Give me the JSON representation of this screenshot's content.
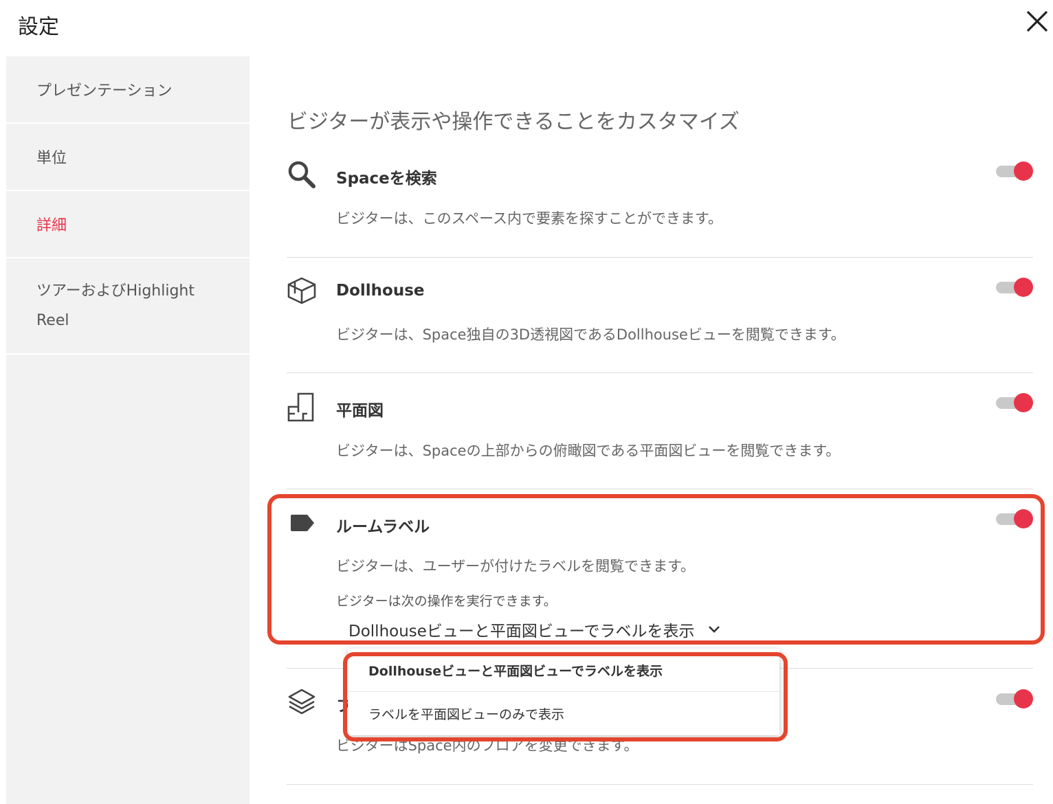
{
  "window": {
    "title": "設定"
  },
  "sidebar": {
    "items": [
      {
        "label": "プレゼンテーション",
        "active": false
      },
      {
        "label": "単位",
        "active": false
      },
      {
        "label": "詳細",
        "active": true
      },
      {
        "label": "ツアーおよびHighlight Reel",
        "active": false
      }
    ]
  },
  "main": {
    "headline": "ビジターが表示や操作できることをカスタマイズ",
    "sections": [
      {
        "title": "Spaceを検索",
        "description": "ビジターは、このスペース内で要素を探すことができます。",
        "icon": "search-icon",
        "enabled": true
      },
      {
        "title": "Dollhouse",
        "description": "ビジターは、Space独自の3D透視図であるDollhouseビューを閲覧できます。",
        "icon": "dollhouse-icon",
        "enabled": true
      },
      {
        "title": "平面図",
        "description": "ビジターは、Spaceの上部からの俯瞰図である平面図ビューを閲覧できます。",
        "icon": "floorplan-icon",
        "enabled": true
      },
      {
        "title": "ルームラベル",
        "description": "ビジターは、ユーザーが付けたラベルを閲覧できます。",
        "icon": "label-icon",
        "enabled": true,
        "sub_label": "ビジターは次の操作を実行できます。",
        "selected_option": "Dollhouseビューと平面図ビューでラベルを表示"
      },
      {
        "title": "フ",
        "description": "ビジターはSpace内のフロアを変更できます。",
        "icon": "layers-icon",
        "enabled": true
      }
    ],
    "dropdown_options": [
      "Dollhouseビューと平面図ビューでラベルを表示",
      "ラベルを平面図ビューのみで表示"
    ]
  },
  "colors": {
    "accent": "#e8344a",
    "highlight": "#e5452e",
    "toggle_track": "#c9c9c9"
  }
}
